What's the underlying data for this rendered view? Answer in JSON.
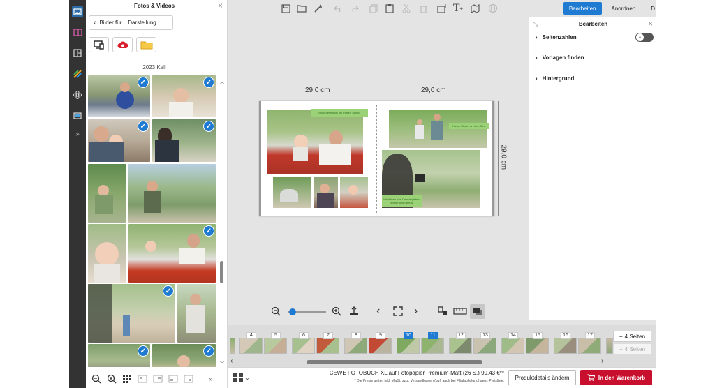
{
  "panel": {
    "title": "Fotos & Videos",
    "back_label": "Bilder für ...Darstellung",
    "folder_label": "2023 Kell"
  },
  "top_tabs": {
    "bearbeiten": "Bearbeiten",
    "anordnen": "Anordnen",
    "next": "D"
  },
  "canvas": {
    "width_left": "29,0 cm",
    "width_right": "29,0 cm",
    "height": "29,0 cm",
    "captions": {
      "c1": "Sooo gemütlich bei Papa's Schoß",
      "c2": "Kleine Kinder an dem See",
      "c3": "Wir lieben das Campingleben immer und überall"
    }
  },
  "right_panel": {
    "title": "Bearbeiten",
    "items": [
      "Seitenzahlen",
      "Vorlagen finden",
      "Hintergrund"
    ]
  },
  "strip": {
    "page_numbers": [
      "4",
      "5",
      "6",
      "7",
      "8",
      "9",
      "10",
      "11",
      "12",
      "13",
      "14",
      "15",
      "16",
      "17"
    ],
    "selected_pages": [
      "10",
      "11"
    ],
    "add_pages": "4 Seiten",
    "remove_pages": "4 Seiten"
  },
  "bottom": {
    "product": "CEWE FOTOBUCH XL auf Fotopapier Premium-Matt (26 S.) 90,43 €**",
    "note": "* Die Preise gelten inkl. MwSt. zzgl. Versandkosten (ggf. auch bei Filialabholung) gem. Preisliste.",
    "details_button": "Produktdetails ändern",
    "cart_button": "In den Warenkorb"
  },
  "colors": {
    "accent": "#1f7ad1",
    "cart": "#c8102e",
    "caption_green": "#9bd277",
    "rail": "#333333"
  }
}
